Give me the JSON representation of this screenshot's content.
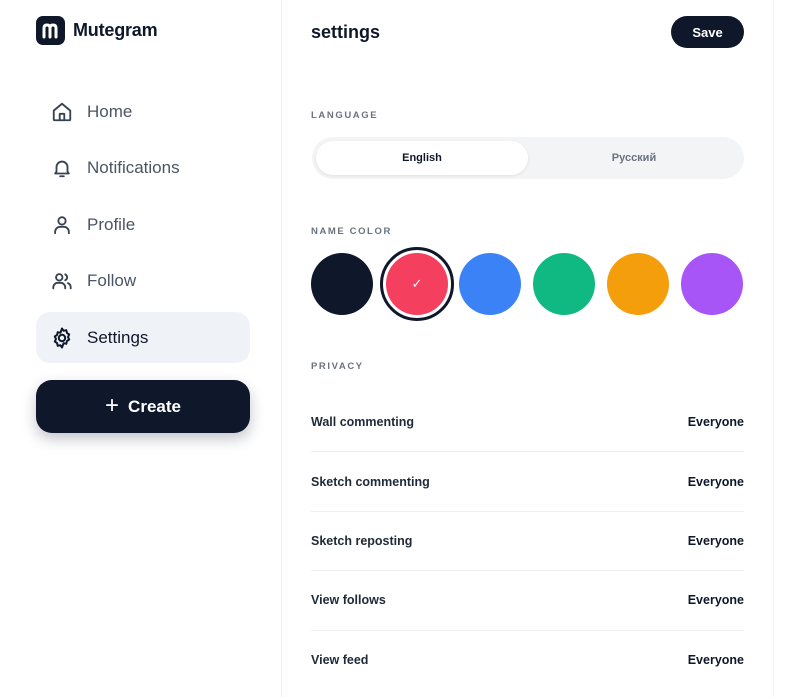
{
  "brand": {
    "name": "Mutegram"
  },
  "nav": {
    "items": [
      {
        "label": "Home",
        "icon": "home-icon",
        "active": false
      },
      {
        "label": "Notifications",
        "icon": "bell-icon",
        "active": false
      },
      {
        "label": "Profile",
        "icon": "user-icon",
        "active": false
      },
      {
        "label": "Follow",
        "icon": "users-icon",
        "active": false
      },
      {
        "label": "Settings",
        "icon": "gear-icon",
        "active": true
      }
    ],
    "create_label": "Create"
  },
  "header": {
    "title": "settings",
    "save_label": "Save"
  },
  "language": {
    "section_label": "LANGUAGE",
    "options": [
      "English",
      "Русский"
    ],
    "selected": "English"
  },
  "name_color": {
    "section_label": "NAME COLOR",
    "swatches": [
      "#0f172a",
      "#f43f5e",
      "#3b82f6",
      "#10b981",
      "#f59e0b",
      "#a855f7"
    ],
    "selected": "#f43f5e"
  },
  "privacy": {
    "section_label": "PRIVACY",
    "rows": [
      {
        "label": "Wall commenting",
        "value": "Everyone"
      },
      {
        "label": "Sketch commenting",
        "value": "Everyone"
      },
      {
        "label": "Sketch reposting",
        "value": "Everyone"
      },
      {
        "label": "View follows",
        "value": "Everyone"
      },
      {
        "label": "View feed",
        "value": "Everyone"
      }
    ]
  }
}
